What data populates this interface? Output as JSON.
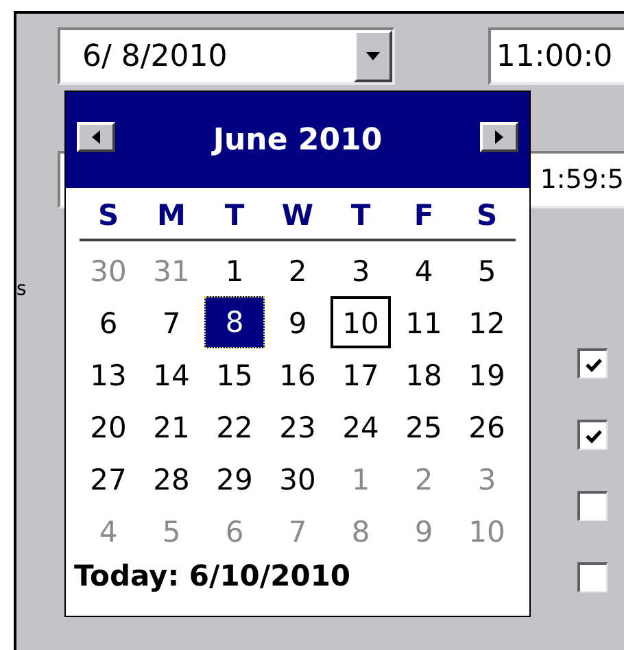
{
  "date_field": {
    "value": "6/ 8/2010"
  },
  "time_fields": [
    {
      "value": "11:00:0"
    },
    {
      "value": "1:59:5"
    }
  ],
  "side_label": "s",
  "checkboxes": [
    {
      "checked": true
    },
    {
      "checked": true
    },
    {
      "checked": false
    },
    {
      "checked": false
    }
  ],
  "calendar": {
    "title": "June 2010",
    "weekdays": [
      "S",
      "M",
      "T",
      "W",
      "T",
      "F",
      "S"
    ],
    "weeks": [
      [
        {
          "day": "30",
          "other_month": true,
          "selected": false,
          "today": false
        },
        {
          "day": "31",
          "other_month": true,
          "selected": false,
          "today": false
        },
        {
          "day": "1",
          "other_month": false,
          "selected": false,
          "today": false
        },
        {
          "day": "2",
          "other_month": false,
          "selected": false,
          "today": false
        },
        {
          "day": "3",
          "other_month": false,
          "selected": false,
          "today": false
        },
        {
          "day": "4",
          "other_month": false,
          "selected": false,
          "today": false
        },
        {
          "day": "5",
          "other_month": false,
          "selected": false,
          "today": false
        }
      ],
      [
        {
          "day": "6",
          "other_month": false,
          "selected": false,
          "today": false
        },
        {
          "day": "7",
          "other_month": false,
          "selected": false,
          "today": false
        },
        {
          "day": "8",
          "other_month": false,
          "selected": true,
          "today": false
        },
        {
          "day": "9",
          "other_month": false,
          "selected": false,
          "today": false
        },
        {
          "day": "10",
          "other_month": false,
          "selected": false,
          "today": true
        },
        {
          "day": "11",
          "other_month": false,
          "selected": false,
          "today": false
        },
        {
          "day": "12",
          "other_month": false,
          "selected": false,
          "today": false
        }
      ],
      [
        {
          "day": "13",
          "other_month": false,
          "selected": false,
          "today": false
        },
        {
          "day": "14",
          "other_month": false,
          "selected": false,
          "today": false
        },
        {
          "day": "15",
          "other_month": false,
          "selected": false,
          "today": false
        },
        {
          "day": "16",
          "other_month": false,
          "selected": false,
          "today": false
        },
        {
          "day": "17",
          "other_month": false,
          "selected": false,
          "today": false
        },
        {
          "day": "18",
          "other_month": false,
          "selected": false,
          "today": false
        },
        {
          "day": "19",
          "other_month": false,
          "selected": false,
          "today": false
        }
      ],
      [
        {
          "day": "20",
          "other_month": false,
          "selected": false,
          "today": false
        },
        {
          "day": "21",
          "other_month": false,
          "selected": false,
          "today": false
        },
        {
          "day": "22",
          "other_month": false,
          "selected": false,
          "today": false
        },
        {
          "day": "23",
          "other_month": false,
          "selected": false,
          "today": false
        },
        {
          "day": "24",
          "other_month": false,
          "selected": false,
          "today": false
        },
        {
          "day": "25",
          "other_month": false,
          "selected": false,
          "today": false
        },
        {
          "day": "26",
          "other_month": false,
          "selected": false,
          "today": false
        }
      ],
      [
        {
          "day": "27",
          "other_month": false,
          "selected": false,
          "today": false
        },
        {
          "day": "28",
          "other_month": false,
          "selected": false,
          "today": false
        },
        {
          "day": "29",
          "other_month": false,
          "selected": false,
          "today": false
        },
        {
          "day": "30",
          "other_month": false,
          "selected": false,
          "today": false
        },
        {
          "day": "1",
          "other_month": true,
          "selected": false,
          "today": false
        },
        {
          "day": "2",
          "other_month": true,
          "selected": false,
          "today": false
        },
        {
          "day": "3",
          "other_month": true,
          "selected": false,
          "today": false
        }
      ],
      [
        {
          "day": "4",
          "other_month": true,
          "selected": false,
          "today": false
        },
        {
          "day": "5",
          "other_month": true,
          "selected": false,
          "today": false
        },
        {
          "day": "6",
          "other_month": true,
          "selected": false,
          "today": false
        },
        {
          "day": "7",
          "other_month": true,
          "selected": false,
          "today": false
        },
        {
          "day": "8",
          "other_month": true,
          "selected": false,
          "today": false
        },
        {
          "day": "9",
          "other_month": true,
          "selected": false,
          "today": false
        },
        {
          "day": "10",
          "other_month": true,
          "selected": false,
          "today": false
        }
      ]
    ],
    "today_label": "Today: 6/10/2010"
  }
}
